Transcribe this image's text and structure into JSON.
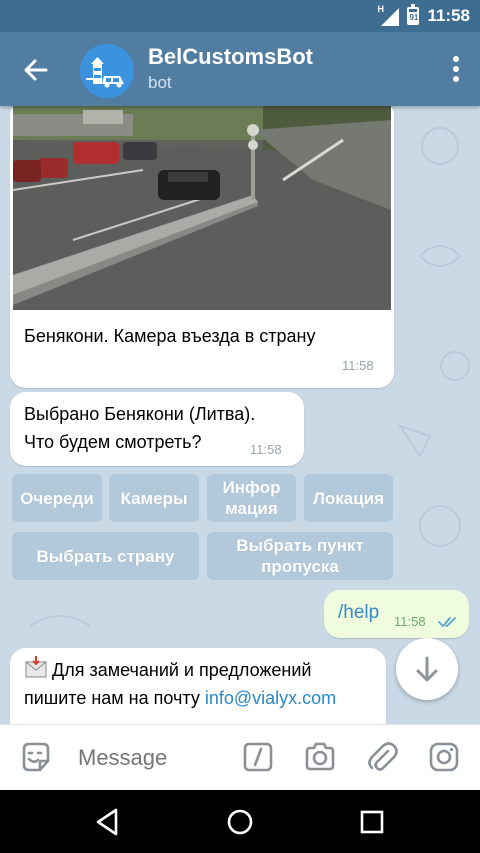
{
  "status_bar": {
    "network_label": "H",
    "battery_level": "91",
    "time": "11:58"
  },
  "header": {
    "title": "BelCustomsBot",
    "subtitle": "bot"
  },
  "messages": {
    "photo_caption": "Бенякони. Камера въезда в страну",
    "photo_time": "11:58",
    "selection_line1": "Выбрано Бенякони (Литва).",
    "selection_line2": "Что будем смотреть?",
    "selection_time": "11:58",
    "outgoing_text": "/help",
    "outgoing_time": "11:58",
    "help_line1": "Для замечаний и предложений",
    "help_line2_prefix": "пишите нам на почту",
    "help_email": "info@vialyx.com"
  },
  "keyboard": {
    "queues": "Очереди",
    "cameras": "Камеры",
    "info_line1": "Инфор",
    "info_line2": "мация",
    "location": "Локация",
    "choose_country": "Выбрать страну",
    "choose_point_line1": "Выбрать пункт",
    "choose_point_line2": "пропуска"
  },
  "composer": {
    "placeholder": "Message"
  },
  "colors": {
    "app_bar": "#517da2",
    "status_bar": "#3d6e92",
    "chat_bg": "#cad9e6",
    "link": "#2a88c8",
    "outgoing_text": "#3a89c9",
    "read_check": "#5aa4d8"
  },
  "icons": {
    "back": "arrow-left-icon",
    "menu": "more-vertical-icon",
    "emoji": "sticker-icon",
    "command": "slash-command-icon",
    "camera": "camera-icon",
    "attach": "paperclip-icon",
    "instagram": "instagram-icon",
    "scroll": "arrow-down-icon",
    "mail": "envelope-icon"
  }
}
